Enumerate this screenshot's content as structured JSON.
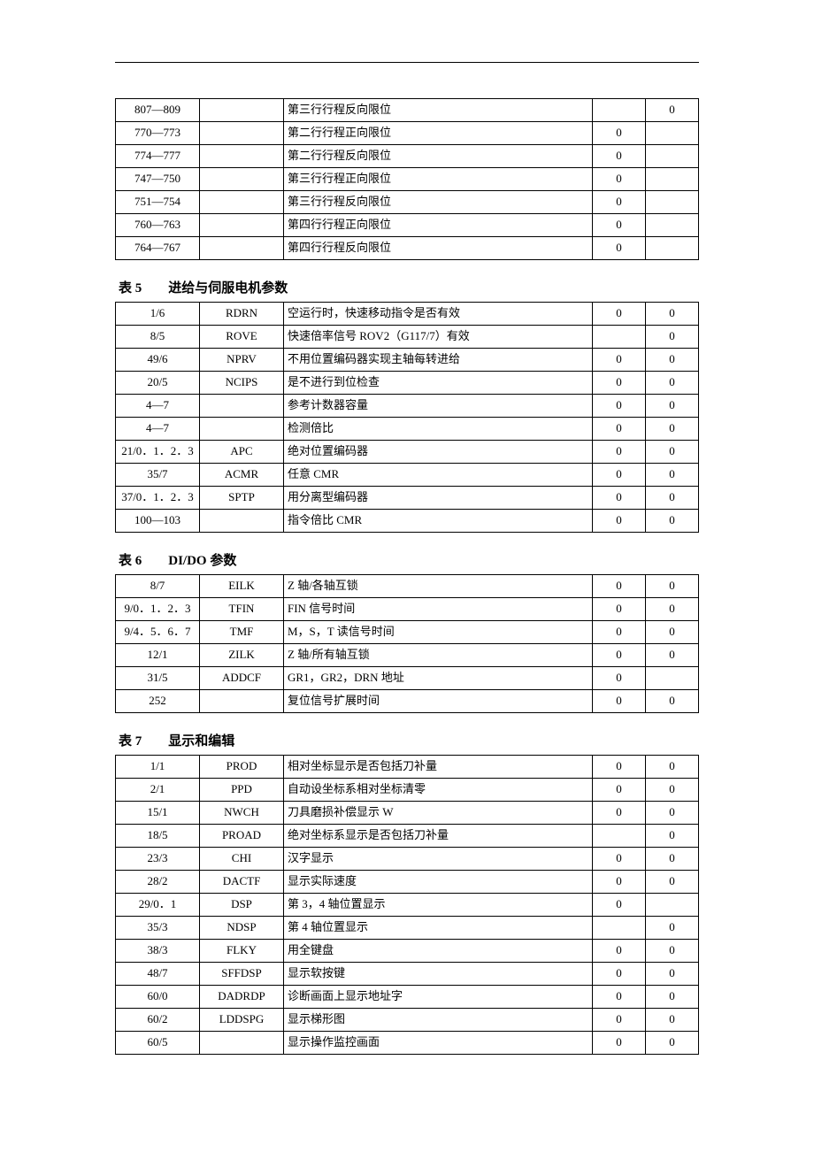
{
  "tables": [
    {
      "title": "",
      "rows": [
        {
          "p": "807—809",
          "s": "",
          "d": "第三行行程反向限位",
          "a": "",
          "b": "0"
        },
        {
          "p": "770—773",
          "s": "",
          "d": "第二行行程正向限位",
          "a": "0",
          "b": ""
        },
        {
          "p": "774—777",
          "s": "",
          "d": "第二行行程反向限位",
          "a": "0",
          "b": ""
        },
        {
          "p": "747—750",
          "s": "",
          "d": "第三行行程正向限位",
          "a": "0",
          "b": ""
        },
        {
          "p": "751—754",
          "s": "",
          "d": "第三行行程反向限位",
          "a": "0",
          "b": ""
        },
        {
          "p": "760—763",
          "s": "",
          "d": "第四行行程正向限位",
          "a": "0",
          "b": ""
        },
        {
          "p": "764—767",
          "s": "",
          "d": "第四行行程反向限位",
          "a": "0",
          "b": ""
        }
      ]
    },
    {
      "title_num": "表 5",
      "title_txt": "进给与伺服电机参数",
      "rows": [
        {
          "p": "1/6",
          "s": "RDRN",
          "d": "空运行时，快速移动指令是否有效",
          "a": "0",
          "b": "0"
        },
        {
          "p": "8/5",
          "s": "ROVE",
          "d": "快速倍率信号 ROV2（G117/7）有效",
          "a": "",
          "b": "0"
        },
        {
          "p": "49/6",
          "s": "NPRV",
          "d": "不用位置编码器实现主轴每转进给",
          "a": "0",
          "b": "0"
        },
        {
          "p": "20/5",
          "s": "NCIPS",
          "d": "是不进行到位检查",
          "a": "0",
          "b": "0"
        },
        {
          "p": "4—7",
          "s": "",
          "d": "参考计数器容量",
          "a": "0",
          "b": "0"
        },
        {
          "p": "4—7",
          "s": "",
          "d": "检测倍比",
          "a": "0",
          "b": "0"
        },
        {
          "p": "21/0．1．2．3",
          "s": "APC",
          "d": "绝对位置编码器",
          "a": "0",
          "b": "0"
        },
        {
          "p": "35/7",
          "s": "ACMR",
          "d": "任意 CMR",
          "a": "0",
          "b": "0"
        },
        {
          "p": "37/0．1．2．3",
          "s": "SPTP",
          "d": "用分离型编码器",
          "a": "0",
          "b": "0"
        },
        {
          "p": "100—103",
          "s": "",
          "d": "指令倍比 CMR",
          "a": "0",
          "b": "0"
        }
      ]
    },
    {
      "title_num": "表 6",
      "title_txt": "DI/DO 参数",
      "rows": [
        {
          "p": "8/7",
          "s": "EILK",
          "d": "Z 轴/各轴互锁",
          "a": "0",
          "b": "0"
        },
        {
          "p": "9/0．1．2．3",
          "s": "TFIN",
          "d": "FIN 信号时间",
          "a": "0",
          "b": "0"
        },
        {
          "p": "9/4．5．6．7",
          "s": "TMF",
          "d": "M，S，T 读信号时间",
          "a": "0",
          "b": "0"
        },
        {
          "p": "12/1",
          "s": "ZILK",
          "d": "Z 轴/所有轴互锁",
          "a": "0",
          "b": "0"
        },
        {
          "p": "31/5",
          "s": "ADDCF",
          "d": "GR1，GR2，DRN 地址",
          "a": "0",
          "b": ""
        },
        {
          "p": "252",
          "s": "",
          "d": "复位信号扩展时间",
          "a": "0",
          "b": "0"
        }
      ]
    },
    {
      "title_num": "表 7",
      "title_txt": "显示和编辑",
      "rows": [
        {
          "p": "1/1",
          "s": "PROD",
          "d": "相对坐标显示是否包括刀补量",
          "a": "0",
          "b": "0"
        },
        {
          "p": "2/1",
          "s": "PPD",
          "d": "自动设坐标系相对坐标清零",
          "a": "0",
          "b": "0"
        },
        {
          "p": "15/1",
          "s": "NWCH",
          "d": "刀具磨损补偿显示 W",
          "a": "0",
          "b": "0"
        },
        {
          "p": "18/5",
          "s": "PROAD",
          "d": "绝对坐标系显示是否包括刀补量",
          "a": "",
          "b": "0"
        },
        {
          "p": "23/3",
          "s": "CHI",
          "d": "汉字显示",
          "a": "0",
          "b": "0"
        },
        {
          "p": "28/2",
          "s": "DACTF",
          "d": "显示实际速度",
          "a": "0",
          "b": "0"
        },
        {
          "p": "29/0．1",
          "s": "DSP",
          "d": "第 3，4 轴位置显示",
          "a": "0",
          "b": ""
        },
        {
          "p": "35/3",
          "s": "NDSP",
          "d": "第 4 轴位置显示",
          "a": "",
          "b": "0"
        },
        {
          "p": "38/3",
          "s": "FLKY",
          "d": "用全键盘",
          "a": "0",
          "b": "0"
        },
        {
          "p": "48/7",
          "s": "SFFDSP",
          "d": "显示软按键",
          "a": "0",
          "b": "0"
        },
        {
          "p": "60/0",
          "s": "DADRDP",
          "d": "诊断画面上显示地址字",
          "a": "0",
          "b": "0"
        },
        {
          "p": "60/2",
          "s": "LDDSPG",
          "d": "显示梯形图",
          "a": "0",
          "b": "0"
        },
        {
          "p": "60/5",
          "s": "",
          "d": "显示操作监控画面",
          "a": "0",
          "b": "0"
        }
      ]
    }
  ]
}
